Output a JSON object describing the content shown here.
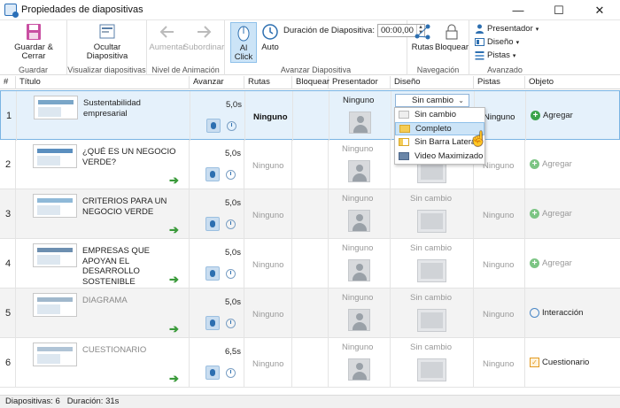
{
  "window": {
    "title": "Propiedades de diapositivas",
    "min": "—",
    "max": "☐",
    "close": "✕"
  },
  "ribbon": {
    "guardar": {
      "label": "Guardar & Cerrar",
      "group": "Guardar"
    },
    "ocultar": {
      "label1": "Ocultar",
      "label2": "Diapositiva",
      "group": "Visualizar diapositivas"
    },
    "aumentar": "Aumentar",
    "subordinar": "Subordinar",
    "nivel_group": "Nivel de Animación",
    "alclick1": "Al",
    "alclick2": "Click",
    "auto": "Auto",
    "duracion_label": "Duración de Diapositiva:",
    "duracion_value": "00:00,00",
    "avanzar_group": "Avanzar Diapositiva",
    "rutas": "Rutas",
    "bloquear": "Bloquear",
    "nav_group": "Navegación",
    "presentador": "Presentador",
    "diseno": "Diseño",
    "pistas": "Pistas",
    "avanzado_group": "Avanzado"
  },
  "columns": [
    "#",
    "Título",
    "Avanzar",
    "Rutas",
    "Bloquear",
    "Presentador",
    "Diseño",
    "Pistas",
    "Objeto"
  ],
  "rows": [
    {
      "num": "1",
      "title": "Sustentabilidad empresarial",
      "time": "5,0s",
      "rutas": "Ninguno",
      "presentador": "Ninguno",
      "diseno": "Sin cambio",
      "pistas": "Ninguno",
      "objeto": "Agregar"
    },
    {
      "num": "2",
      "title": "¿QUÉ ES UN NEGOCIO VERDE?",
      "time": "5,0s",
      "rutas": "Ninguno",
      "presentador": "Ninguno",
      "diseno": "Sin cambio",
      "pistas": "Ninguno",
      "objeto": "Agregar"
    },
    {
      "num": "3",
      "title": "CRITERIOS PARA UN NEGOCIO VERDE",
      "time": "5,0s",
      "rutas": "Ninguno",
      "presentador": "Ninguno",
      "diseno": "Sin cambio",
      "pistas": "Ninguno",
      "objeto": "Agregar"
    },
    {
      "num": "4",
      "title": "EMPRESAS QUE APOYAN EL DESARROLLO SOSTENIBLE",
      "time": "5,0s",
      "rutas": "Ninguno",
      "presentador": "Ninguno",
      "diseno": "Sin cambio",
      "pistas": "Ninguno",
      "objeto": "Agregar"
    },
    {
      "num": "5",
      "title": "DIAGRAMA",
      "time": "5,0s",
      "rutas": "Ninguno",
      "presentador": "Ninguno",
      "diseno": "Sin cambio",
      "pistas": "Ninguno",
      "objeto": "Interacción"
    },
    {
      "num": "6",
      "title": "CUESTIONARIO",
      "time": "6,5s",
      "rutas": "Ninguno",
      "presentador": "Ninguno",
      "diseno": "Sin cambio",
      "pistas": "Ninguno",
      "objeto": "Cuestionario"
    }
  ],
  "dropdown": {
    "value": "Sin cambio",
    "options": [
      "Sin cambio",
      "Completo",
      "Sin Barra Lateral",
      "Video Maximizado"
    ]
  },
  "status": {
    "slides": "Diapositivas: 6",
    "duration": "Duración: 31s"
  },
  "colors": {
    "accent": "#2a6fb8",
    "selection": "#e5f1fb",
    "green": "#3aa34a"
  }
}
